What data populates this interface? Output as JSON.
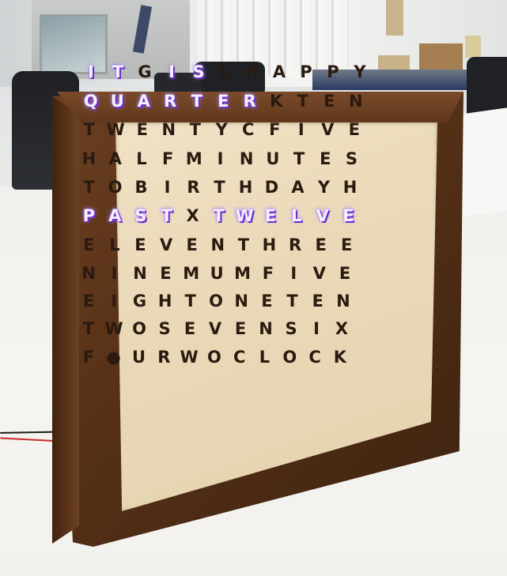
{
  "word_clock": {
    "rows": [
      {
        "letters": [
          "I",
          "T",
          "G",
          "I",
          "S",
          "L",
          "H",
          "A",
          "P",
          "P",
          "Y"
        ],
        "lit": [
          true,
          true,
          false,
          true,
          true,
          false,
          false,
          false,
          false,
          false,
          false
        ]
      },
      {
        "letters": [
          "Q",
          "U",
          "A",
          "R",
          "T",
          "E",
          "R",
          "K",
          "T",
          "E",
          "N"
        ],
        "lit": [
          true,
          true,
          true,
          true,
          true,
          true,
          true,
          false,
          false,
          false,
          false
        ]
      },
      {
        "letters": [
          "T",
          "W",
          "E",
          "N",
          "T",
          "Y",
          "C",
          "F",
          "I",
          "V",
          "E"
        ],
        "lit": [
          false,
          false,
          false,
          false,
          false,
          false,
          false,
          false,
          false,
          false,
          false
        ]
      },
      {
        "letters": [
          "H",
          "A",
          "L",
          "F",
          "M",
          "I",
          "N",
          "U",
          "T",
          "E",
          "S"
        ],
        "lit": [
          false,
          false,
          false,
          false,
          false,
          false,
          false,
          false,
          false,
          false,
          false
        ]
      },
      {
        "letters": [
          "T",
          "O",
          "B",
          "I",
          "R",
          "T",
          "H",
          "D",
          "A",
          "Y",
          "H"
        ],
        "lit": [
          false,
          false,
          false,
          false,
          false,
          false,
          false,
          false,
          false,
          false,
          false
        ]
      },
      {
        "letters": [
          "P",
          "A",
          "S",
          "T",
          "X",
          "T",
          "W",
          "E",
          "L",
          "V",
          "E"
        ],
        "lit": [
          true,
          true,
          true,
          true,
          false,
          true,
          true,
          true,
          true,
          true,
          true
        ]
      },
      {
        "letters": [
          "E",
          "L",
          "E",
          "V",
          "E",
          "N",
          "T",
          "H",
          "R",
          "E",
          "E"
        ],
        "lit": [
          false,
          false,
          false,
          false,
          false,
          false,
          false,
          false,
          false,
          false,
          false
        ]
      },
      {
        "letters": [
          "N",
          "I",
          "N",
          "E",
          "M",
          "U",
          "M",
          "F",
          "I",
          "V",
          "E"
        ],
        "lit": [
          false,
          false,
          false,
          false,
          false,
          false,
          false,
          false,
          false,
          false,
          false
        ]
      },
      {
        "letters": [
          "E",
          "I",
          "G",
          "H",
          "T",
          "O",
          "N",
          "E",
          "T",
          "E",
          "N"
        ],
        "lit": [
          false,
          false,
          false,
          false,
          false,
          false,
          false,
          false,
          false,
          false,
          false
        ]
      },
      {
        "letters": [
          "T",
          "W",
          "O",
          "S",
          "E",
          "V",
          "E",
          "N",
          "S",
          "I",
          "X"
        ],
        "lit": [
          false,
          false,
          false,
          false,
          false,
          false,
          false,
          false,
          false,
          false,
          false
        ]
      },
      {
        "letters": [
          "F",
          "●",
          "U",
          "R",
          "W",
          "O",
          "C",
          "L",
          "O",
          "C",
          "K"
        ],
        "lit": [
          false,
          false,
          false,
          false,
          false,
          false,
          false,
          false,
          false,
          false,
          false
        ]
      }
    ],
    "led_color": "#7b3cff",
    "frame_color": "#5a3318",
    "face_color": "#ead9b8"
  }
}
